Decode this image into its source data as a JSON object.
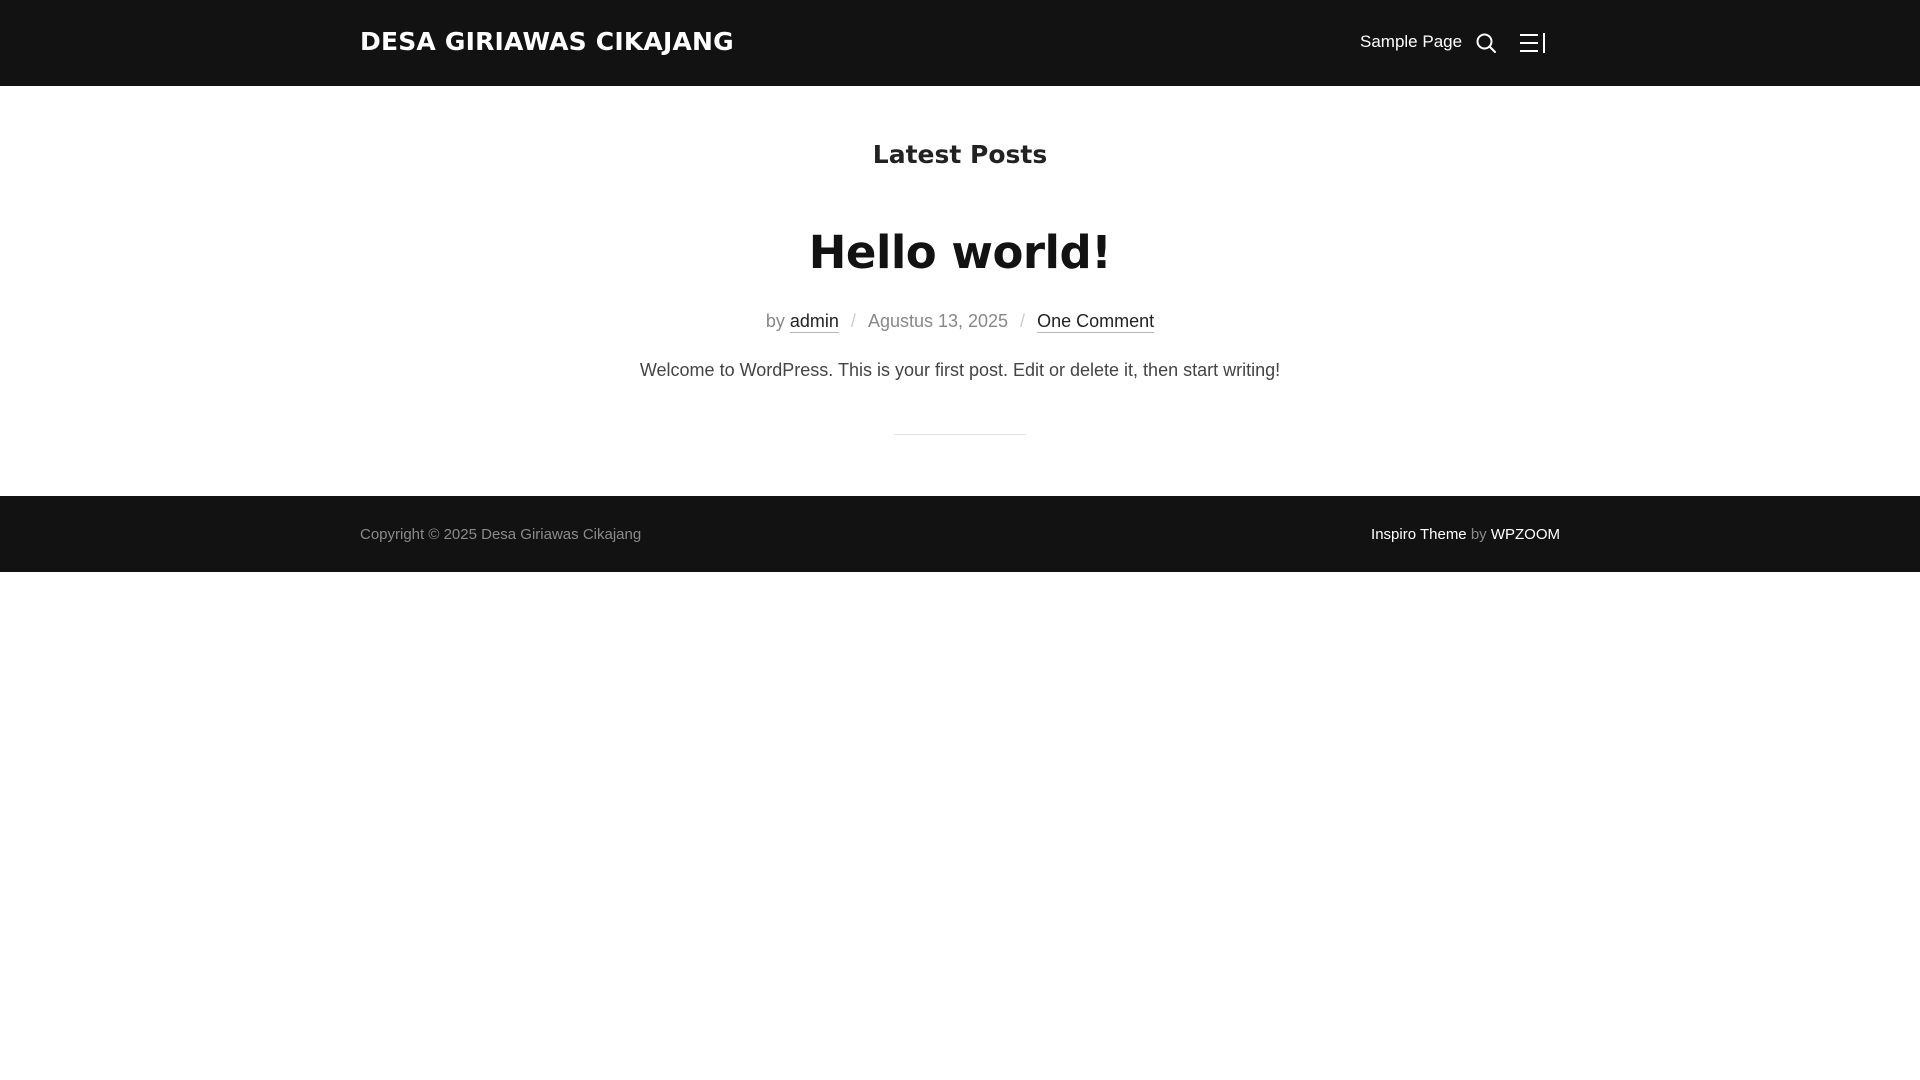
{
  "header": {
    "site_title": "DESA GIRIAWAS CIKAJANG",
    "nav": [
      {
        "label": "Sample Page"
      }
    ],
    "search_icon": "search-icon",
    "menu_icon": "sidebar-menu-icon"
  },
  "main": {
    "heading": "Latest Posts",
    "post": {
      "title": "Hello world!",
      "by_label": "by",
      "author": "admin",
      "date": "Agustus 13, 2025",
      "comments": "One Comment",
      "separator": "/",
      "excerpt": "Welcome to WordPress. This is your first post. Edit or delete it, then start writing!"
    }
  },
  "footer": {
    "copyright": "Copyright © 2025 Desa Giriawas Cikajang",
    "theme_label": "Inspiro Theme",
    "by_label": "by",
    "vendor_label": "WPZOOM"
  },
  "colors": {
    "header_bg": "#121212",
    "footer_bg": "#121212",
    "page_bg": "#ffffff",
    "heading_text": "#222222",
    "muted_text": "#888888"
  }
}
